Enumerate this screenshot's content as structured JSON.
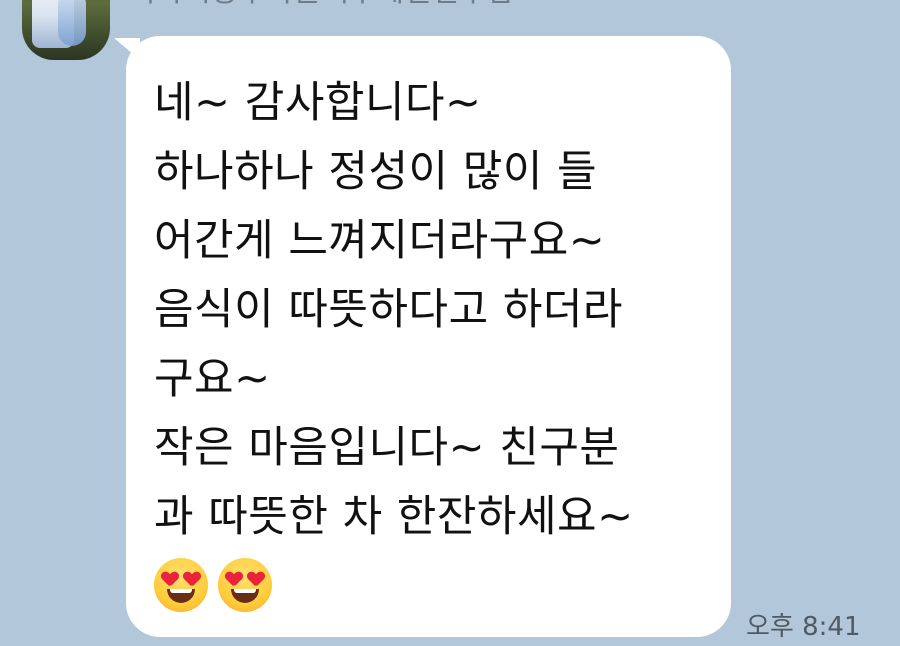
{
  "chat": {
    "sender_name": "이마시장우사본백우혜진선우맘",
    "message_lines": [
      "네~ 감사합니다~",
      "하나하나 정성이 많이 들",
      "어간게 느껴지더라구요~",
      "음식이 따뜻하다고 하더라",
      "구요~",
      "작은 마음입니다~ 친구분",
      "과 따뜻한 차 한잔하세요~"
    ],
    "emojis": [
      "heart-eyes-emoji",
      "heart-eyes-emoji"
    ],
    "timestamp": "오후 8:41"
  },
  "colors": {
    "background": "#b2c7d9",
    "bubble": "#ffffff",
    "text": "#111111",
    "sender_name": "#6f7d89",
    "timestamp": "#4f5a64"
  }
}
